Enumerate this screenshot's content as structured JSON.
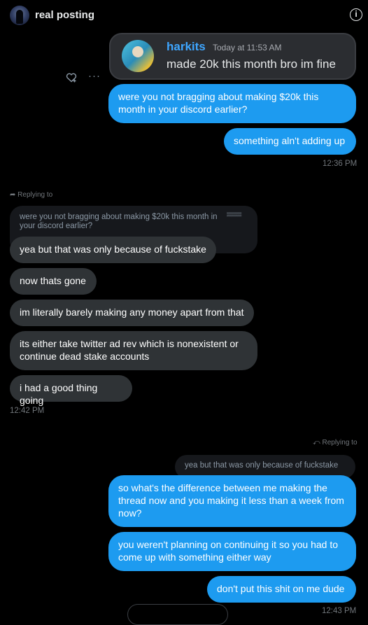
{
  "header": {
    "title": "real posting"
  },
  "embed": {
    "username": "harkits",
    "timestamp": "Today at 11:53 AM",
    "message": "made 20k this month bro im fine"
  },
  "messages": {
    "out1": "were you not bragging about making $20k this month in your discord earlier?",
    "out2": "something aln't adding up",
    "ts1": "12:36 PM",
    "reply_in_label": "Replying to",
    "quote_in": "were you not bragging about making $20k this month in your discord earlier?",
    "in1": "yea but that was only because of fuckstake",
    "in2": "now thats gone",
    "in3": "im literally barely making any money apart from that",
    "in4": "its either take twitter ad rev which is nonexistent or continue dead stake accounts",
    "in5": "i had a good thing going",
    "ts2": "12:42 PM",
    "reply_out_label": "Replying to",
    "quote_out": "yea but that was only because of fuckstake",
    "out3": "so what's the difference between me making the thread now and you making it less than a week from now?",
    "out4": "you weren't planning on continuing it so you had to come up with something either way",
    "out5": "don't put this shit on me dude",
    "ts3": "12:43 PM"
  },
  "icons": {
    "info": "info-icon",
    "reaction": "add-reaction-icon",
    "more": "more-icon",
    "reply_arrow": "reply-arrow-icon"
  },
  "colors": {
    "outgoing": "#1d9bf0",
    "incoming": "#2f3336",
    "discord_name": "#3ea6ff"
  }
}
